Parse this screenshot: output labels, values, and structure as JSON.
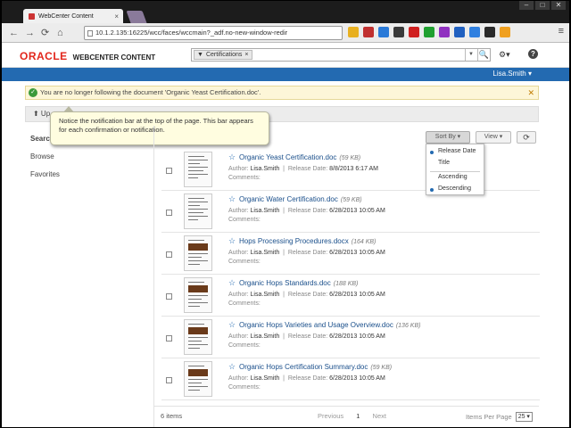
{
  "browser": {
    "tab_title": "WebCenter Content",
    "tab_close": "×",
    "url": "10.1.2.135:16225/wcc/faces/wccmain?_adf.no-new-window-redir",
    "window_controls": [
      "–",
      "□",
      "✕"
    ],
    "ext_colors": [
      "#e8b020",
      "#c03030",
      "#2a7ad8",
      "#3a3a3a",
      "#d02020",
      "#20a030",
      "#9030c0",
      "#2060c0",
      "#3080e0",
      "#2a2a2a",
      "#f0a020"
    ]
  },
  "header": {
    "brand_oracle": "ORACLE",
    "brand_product": "WEBCENTER CONTENT",
    "search_filter": "Certifications",
    "search_filter_clear": "×",
    "search_dropdown": "▼",
    "search_go": "🔍",
    "tools": "⚙▾",
    "help": "?",
    "user": "Lisa.Smith ▾"
  },
  "notification": {
    "text": "You are no longer following the document 'Organic Yeast Certification.doc'.",
    "icon": "✓",
    "close": "✕"
  },
  "upload": {
    "label": "⬆ Up"
  },
  "callout": {
    "text": "Notice the notification bar at the top of the page. This bar appears for each confirmation or notification."
  },
  "sidebar": {
    "items": [
      {
        "label": "Searc"
      },
      {
        "label": "Browse"
      },
      {
        "label": "Favorites"
      }
    ]
  },
  "toolbar": {
    "sort_by": "Sort By ▾",
    "view": "View ▾",
    "refresh": "⟳"
  },
  "sort_menu": {
    "items": [
      "Release Date",
      "Title",
      "Ascending",
      "Descending"
    ],
    "selected": [
      "Release Date",
      "Descending"
    ]
  },
  "labels": {
    "author": "Author:",
    "release_date": "Release Date:",
    "comments": "Comments:",
    "sep": "|"
  },
  "documents": [
    {
      "name": "Organic Yeast Certification.doc",
      "size": "(59 KB)",
      "author": "Lisa.Smith",
      "date": "8/8/2013 6:17 AM",
      "star": "☆"
    },
    {
      "name": "Organic Water Certification.doc",
      "size": "(59 KB)",
      "author": "Lisa.Smith",
      "date": "6/28/2013 10:05 AM",
      "star": "☆"
    },
    {
      "name": "Hops Processing Procedures.docx",
      "size": "(164 KB)",
      "author": "Lisa.Smith",
      "date": "6/28/2013 10:05 AM",
      "star": "☆"
    },
    {
      "name": "Organic Hops Standards.doc",
      "size": "(188 KB)",
      "author": "Lisa.Smith",
      "date": "6/28/2013 10:05 AM",
      "star": "☆"
    },
    {
      "name": "Organic Hops Varieties and Usage Overview.doc",
      "size": "(136 KB)",
      "author": "Lisa.Smith",
      "date": "6/28/2013 10:05 AM",
      "star": "☆"
    },
    {
      "name": "Organic Hops Certification Summary.doc",
      "size": "(59 KB)",
      "author": "Lisa.Smith",
      "date": "6/28/2013 10:05 AM",
      "star": "☆"
    }
  ],
  "footer": {
    "count": "6 items",
    "previous": "Previous",
    "page": "1",
    "next": "Next",
    "items_per_page": "Items Per Page",
    "ipp_value": "25 ▾"
  }
}
